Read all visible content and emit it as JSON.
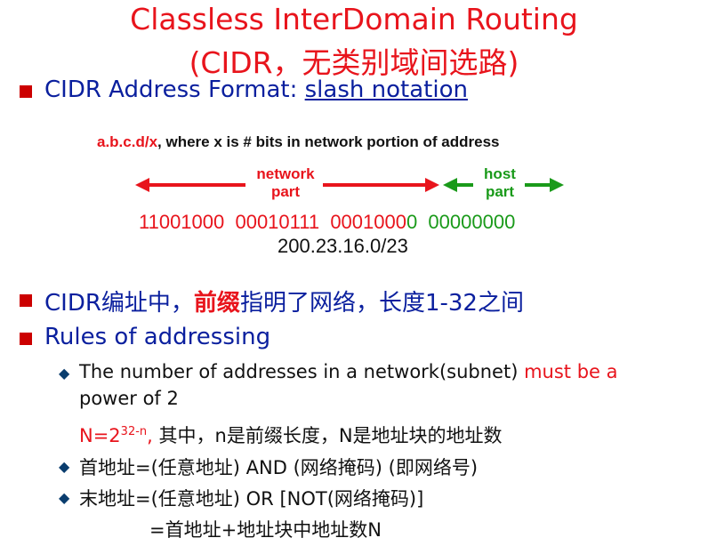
{
  "title": {
    "line1": "Classless InterDomain Routing",
    "line2": "(CIDR，无类别域间选路)"
  },
  "bullet1": {
    "prefix": "CIDR Address Format: ",
    "link": "slash notation"
  },
  "diagram": {
    "caption_red": "a.b.c.d/x",
    "caption_rest": ", where x is # bits in network portion of address",
    "network_label_line1": "network",
    "network_label_line2": "part",
    "host_label_line1": "host",
    "host_label_line2": "part",
    "bits_network": "11001000  00010111  0001000",
    "bits_host_tail": "0  00000000",
    "address": "200.23.16.0/23",
    "colors": {
      "network": "#e8141c",
      "host": "#1a9a1a"
    }
  },
  "bullet2": {
    "before": "CIDR编址中，",
    "highlight": "前缀",
    "after": "指明了网络，长度1-32之间"
  },
  "bullet3": {
    "text": "Rules of addressing"
  },
  "rules": [
    {
      "black": "The number of addresses in a network(subnet) ",
      "red_line1": "must be a",
      "red_line2": "power of 2"
    }
  ],
  "formula": {
    "red_base": "N=2",
    "red_exp": "32-n",
    "red_comma": ",",
    "black": " 其中，n是前缀长度，N是地址块的地址数"
  },
  "rule2": "首地址=(任意地址) AND (网络掩码) (即网络号)",
  "rule3": "末地址=(任意地址) OR [NOT(网络掩码)]",
  "rule3_cont": "=首地址+地址块中地址数N"
}
